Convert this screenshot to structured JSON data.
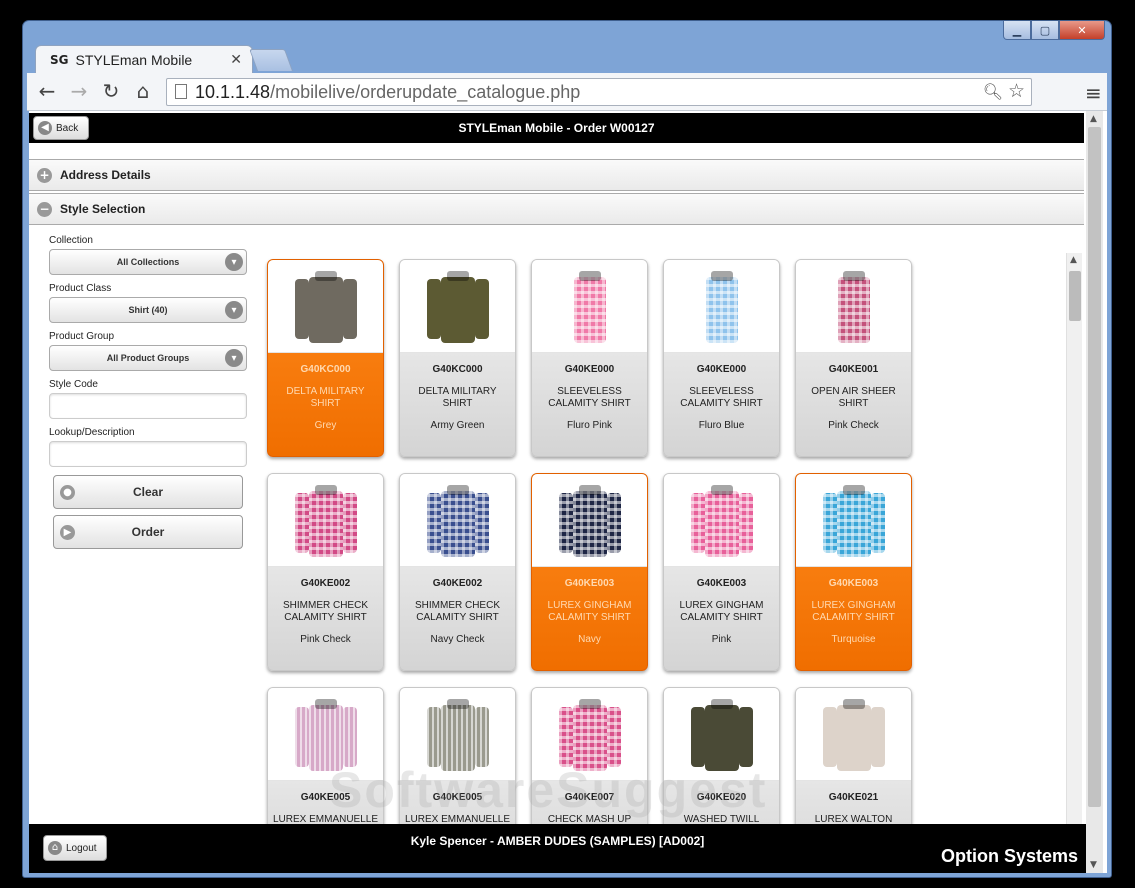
{
  "browser": {
    "tab_title": "STYLEman Mobile",
    "tab_favicon": "SG",
    "url_host": "10.1.1.48",
    "url_path": "/mobilelive/orderupdate_catalogue.php"
  },
  "header": {
    "back_label": "Back",
    "title": "STYLEman Mobile - Order W00127"
  },
  "sections": {
    "address": "Address Details",
    "style": "Style Selection"
  },
  "filters": {
    "collection_label": "Collection",
    "collection_value": "All Collections",
    "product_class_label": "Product Class",
    "product_class_value": "Shirt (40)",
    "product_group_label": "Product Group",
    "product_group_value": "All Product Groups",
    "style_code_label": "Style Code",
    "lookup_label": "Lookup/Description",
    "clear_label": "Clear",
    "order_label": "Order"
  },
  "products": [
    {
      "code": "G40KC000",
      "desc": "DELTA MILITARY SHIRT",
      "colour": "Grey",
      "selected": true,
      "hex": "#6f6a60",
      "pattern": "solid",
      "sleeve": true
    },
    {
      "code": "G40KC000",
      "desc": "DELTA MILITARY SHIRT",
      "colour": "Army Green",
      "selected": false,
      "hex": "#5c5a33",
      "pattern": "solid",
      "sleeve": true
    },
    {
      "code": "G40KE000",
      "desc": "SLEEVELESS CALAMITY SHIRT",
      "colour": "Fluro Pink",
      "selected": false,
      "hex": "#f07aa8",
      "pattern": "check",
      "sleeve": false
    },
    {
      "code": "G40KE000",
      "desc": "SLEEVELESS CALAMITY SHIRT",
      "colour": "Fluro Blue",
      "selected": false,
      "hex": "#8fc3ec",
      "pattern": "check",
      "sleeve": false
    },
    {
      "code": "G40KE001",
      "desc": "OPEN AIR SHEER SHIRT",
      "colour": "Pink Check",
      "selected": false,
      "hex": "#c4527c",
      "pattern": "check",
      "sleeve": false
    },
    {
      "code": "G40KE002",
      "desc": "SHIMMER CHECK CALAMITY SHIRT",
      "colour": "Pink Check",
      "selected": false,
      "hex": "#d24a86",
      "pattern": "check",
      "sleeve": true
    },
    {
      "code": "G40KE002",
      "desc": "SHIMMER CHECK CALAMITY SHIRT",
      "colour": "Navy Check",
      "selected": false,
      "hex": "#3a4f8f",
      "pattern": "check",
      "sleeve": true
    },
    {
      "code": "G40KE003",
      "desc": "LUREX GINGHAM CALAMITY SHIRT",
      "colour": "Navy",
      "selected": true,
      "hex": "#1e2645",
      "pattern": "check",
      "sleeve": true
    },
    {
      "code": "G40KE003",
      "desc": "LUREX GINGHAM CALAMITY SHIRT",
      "colour": "Pink",
      "selected": false,
      "hex": "#e8609a",
      "pattern": "check",
      "sleeve": true
    },
    {
      "code": "G40KE003",
      "desc": "LUREX GINGHAM CALAMITY SHIRT",
      "colour": "Turquoise",
      "selected": true,
      "hex": "#3aa6d8",
      "pattern": "check",
      "sleeve": true
    },
    {
      "code": "G40KE005",
      "desc": "LUREX EMMANUELLE SHIRT",
      "colour": "",
      "selected": false,
      "hex": "#d7a9c8",
      "pattern": "stripe",
      "sleeve": true
    },
    {
      "code": "G40KE005",
      "desc": "LUREX EMMANUELLE SHIRT",
      "colour": "",
      "selected": false,
      "hex": "#9a9a8e",
      "pattern": "stripe",
      "sleeve": true
    },
    {
      "code": "G40KE007",
      "desc": "CHECK MASH UP SHIRT",
      "colour": "",
      "selected": false,
      "hex": "#d9508a",
      "pattern": "check",
      "sleeve": true
    },
    {
      "code": "G40KE020",
      "desc": "WASHED TWILL MILITARY SHIRT",
      "colour": "",
      "selected": false,
      "hex": "#4a4a36",
      "pattern": "solid",
      "sleeve": true
    },
    {
      "code": "G40KE021",
      "desc": "LUREX WALTON SHIRT",
      "colour": "",
      "selected": false,
      "hex": "#ddd3ca",
      "pattern": "solid",
      "sleeve": true
    }
  ],
  "footer": {
    "logout_label": "Logout",
    "user": "Kyle Spencer - AMBER DUDES (SAMPLES) [AD002]",
    "brand": "Option Systems"
  },
  "watermark": "SoftwareSuggest"
}
